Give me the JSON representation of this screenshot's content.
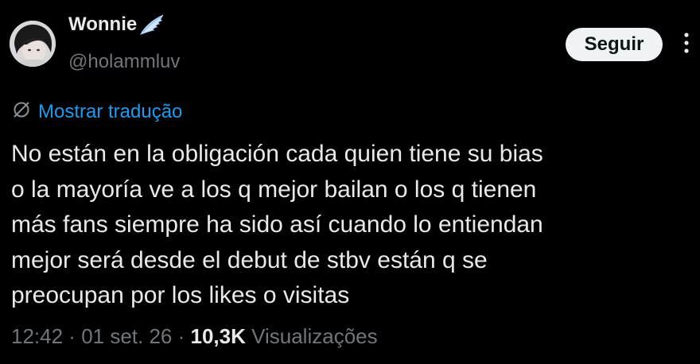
{
  "author": {
    "display_name": "Wonnie",
    "badge_icon": "wing-icon",
    "handle": "@holammluv"
  },
  "follow_button": {
    "label": "Seguir"
  },
  "more_button": {
    "icon": "more-options-icon"
  },
  "translate": {
    "icon": "translate-icon",
    "label": "Mostrar tradução"
  },
  "tweet": {
    "lines": [
      "No están en la obligación cada quien tiene su bias",
      "o la mayoría ve a los q mejor bailan o los q tienen",
      "más fans siempre ha sido así cuando lo entiendan",
      "mejor será desde el debut de stbv están q se",
      "preocupan por los likes o visitas"
    ]
  },
  "meta": {
    "time": "12:42",
    "separator": " · ",
    "date": "01 set. 26",
    "views_count": "10,3K",
    "views_label": " Visualizações"
  },
  "colors": {
    "background": "#000000",
    "text_primary": "#e7e9ea",
    "text_secondary": "#71767b",
    "link": "#1d9bf0",
    "button_bg": "#eff3f4",
    "button_text": "#0f1419"
  }
}
